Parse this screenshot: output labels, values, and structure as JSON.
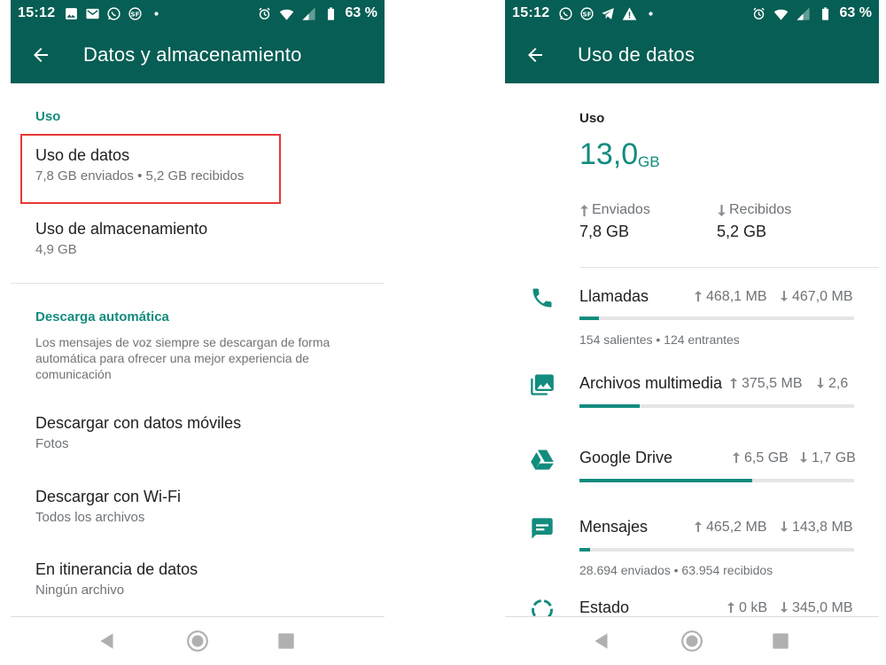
{
  "left_screen": {
    "status_bar": {
      "time": "15:12",
      "battery": "63 %",
      "icons": [
        "image-icon",
        "gmail-icon",
        "whatsapp-icon",
        "sf-icon",
        "dot-icon",
        "alarm-icon",
        "wifi-icon",
        "signal-icon",
        "battery-icon"
      ]
    },
    "app_bar": {
      "title": "Datos y almacenamiento"
    },
    "section_uso": {
      "header": "Uso"
    },
    "uso_datos": {
      "title": "Uso de datos",
      "subtitle": "7,8 GB enviados • 5,2 GB recibidos"
    },
    "uso_almacenamiento": {
      "title": "Uso de almacenamiento",
      "subtitle": "4,9 GB"
    },
    "section_descarga": {
      "header": "Descarga automática",
      "description": "Los mensajes de voz siempre se descargan de forma automática para ofrecer una mejor experiencia de comunicación"
    },
    "descarga_moviles": {
      "title": "Descargar con datos móviles",
      "subtitle": "Fotos"
    },
    "descarga_wifi": {
      "title": "Descargar con Wi-Fi",
      "subtitle": "Todos los archivos"
    },
    "itinerancia": {
      "title": "En itinerancia de datos",
      "subtitle": "Ningún archivo"
    }
  },
  "right_screen": {
    "status_bar": {
      "time": "15:12",
      "battery": "63 %",
      "icons": [
        "whatsapp-icon",
        "sf-icon",
        "telegram-icon",
        "warning-icon",
        "dot-icon",
        "alarm-icon",
        "wifi-icon",
        "signal-icon",
        "battery-icon"
      ]
    },
    "app_bar": {
      "title": "Uso de datos"
    },
    "summary": {
      "label": "Uso",
      "total_value": "13,0",
      "total_unit": "GB",
      "sent_label": "Enviados",
      "sent_value": "7,8 GB",
      "received_label": "Recibidos",
      "received_value": "5,2 GB"
    },
    "categories": [
      {
        "title": "Llamadas",
        "icon": "phone-icon",
        "sent": "468,1 MB",
        "received": "467,0 MB",
        "progress": 0.07,
        "subtitle": "154 salientes • 124 entrantes"
      },
      {
        "title": "Archivos multimedia",
        "icon": "media-icon",
        "sent": "375,5 MB",
        "received": "2,6",
        "progress": 0.22,
        "subtitle": ""
      },
      {
        "title": "Google Drive",
        "icon": "drive-icon",
        "sent": "6,5 GB",
        "received": "1,7 GB",
        "progress": 0.63,
        "subtitle": ""
      },
      {
        "title": "Mensajes",
        "icon": "message-icon",
        "sent": "465,2 MB",
        "received": "143,8 MB",
        "progress": 0.04,
        "subtitle": "28.694 enviados • 63.954 recibidos"
      },
      {
        "title": "Estado",
        "icon": "status-icon",
        "sent": "0 kB",
        "received": "345,0 MB",
        "progress": 0.0,
        "subtitle": ""
      }
    ]
  },
  "colors": {
    "primary_dark": "#075e54",
    "accent": "#128c7e",
    "highlight": "#e53935"
  }
}
